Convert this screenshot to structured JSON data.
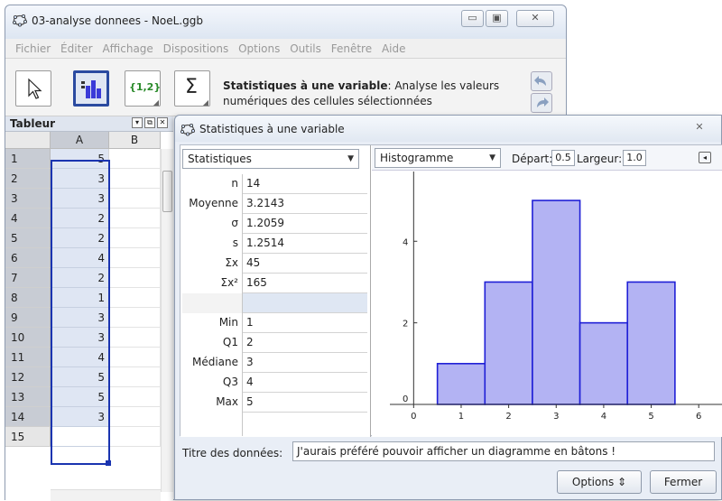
{
  "main_window": {
    "title": "03-analyse donnees - NoeL.ggb",
    "minimize": "▭",
    "maximize": "▣",
    "close": "✕"
  },
  "menu": [
    "Fichier",
    "Éditer",
    "Affichage",
    "Dispositions",
    "Options",
    "Outils",
    "Fenêtre",
    "Aide"
  ],
  "toolbar": {
    "list_tool_label": "{1,2}",
    "sum_tool_label": "Σ",
    "help_bold": "Statistiques à une variable",
    "help_rest": ": Analyse les valeurs numériques des cellules sélectionnées"
  },
  "spreadsheet": {
    "title": "Tableur",
    "col_a": "A",
    "col_b": "B",
    "rows": [
      {
        "num": "1",
        "a": "5"
      },
      {
        "num": "2",
        "a": "3"
      },
      {
        "num": "3",
        "a": "3"
      },
      {
        "num": "4",
        "a": "2"
      },
      {
        "num": "5",
        "a": "2"
      },
      {
        "num": "6",
        "a": "4"
      },
      {
        "num": "7",
        "a": "2"
      },
      {
        "num": "8",
        "a": "1"
      },
      {
        "num": "9",
        "a": "3"
      },
      {
        "num": "10",
        "a": "3"
      },
      {
        "num": "11",
        "a": "4"
      },
      {
        "num": "12",
        "a": "5"
      },
      {
        "num": "13",
        "a": "5"
      },
      {
        "num": "14",
        "a": "3"
      },
      {
        "num": "15",
        "a": ""
      }
    ]
  },
  "dialog": {
    "title": "Statistiques à une variable",
    "close": "✕",
    "stats_combo": "Statistiques",
    "stats": [
      {
        "label": "n",
        "value": "14"
      },
      {
        "label": "Moyenne",
        "value": "3.2143"
      },
      {
        "label": "σ",
        "value": "1.2059"
      },
      {
        "label": "s",
        "value": "1.2514"
      },
      {
        "label": "Σx",
        "value": "45"
      },
      {
        "label": "Σx²",
        "value": "165"
      },
      {
        "label": "",
        "value": ""
      },
      {
        "label": "Min",
        "value": "1"
      },
      {
        "label": "Q1",
        "value": "2"
      },
      {
        "label": "Médiane",
        "value": "3"
      },
      {
        "label": "Q3",
        "value": "4"
      },
      {
        "label": "Max",
        "value": "5"
      }
    ],
    "chart_combo": "Histogramme",
    "start_label": "Départ:",
    "start_value": "0.5",
    "width_label": "Largeur:",
    "width_value": "1.0",
    "data_title_label": "Titre des données:",
    "data_title_value": "J'aurais préféré pouvoir afficher un diagramme en bâtons !",
    "options_button": "Options ⇕",
    "close_button": "Fermer"
  },
  "colors": {
    "bar_fill": "#b3b3f3",
    "bar_stroke": "#1f1fd6",
    "selection": "#1a34b0"
  },
  "chart_data": {
    "type": "bar",
    "chart_kind": "histogram",
    "bins": [
      [
        0.5,
        1.5
      ],
      [
        1.5,
        2.5
      ],
      [
        2.5,
        3.5
      ],
      [
        3.5,
        4.5
      ],
      [
        4.5,
        5.5
      ]
    ],
    "values": [
      1,
      3,
      5,
      2,
      3
    ],
    "xlim": [
      -0.5,
      6.3
    ],
    "ylim": [
      0,
      5.4
    ],
    "x_ticks": [
      0,
      1,
      2,
      3,
      4,
      5,
      6
    ],
    "y_ticks": [
      0,
      2,
      4
    ],
    "grid": false
  }
}
